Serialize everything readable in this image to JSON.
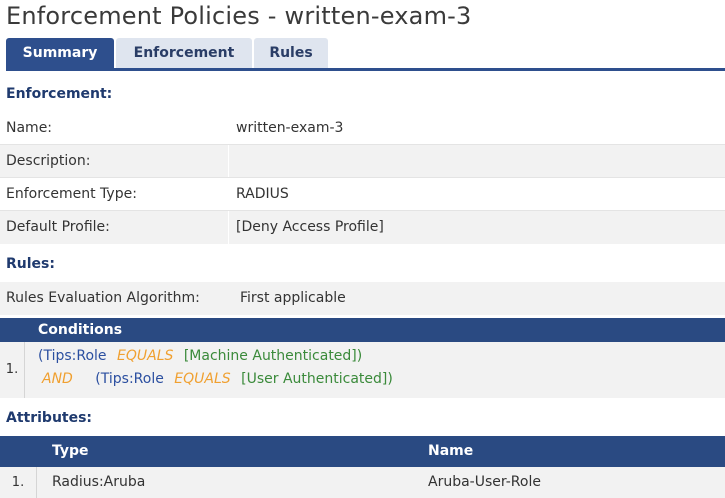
{
  "title": "Enforcement Policies - written-exam-3",
  "tabs": [
    {
      "label": "Summary",
      "active": true
    },
    {
      "label": "Enforcement",
      "active": false
    },
    {
      "label": "Rules",
      "active": false
    }
  ],
  "enforcement": {
    "heading": "Enforcement:",
    "rows": [
      {
        "label": "Name:",
        "value": "written-exam-3"
      },
      {
        "label": "Description:",
        "value": ""
      },
      {
        "label": "Enforcement Type:",
        "value": "RADIUS"
      },
      {
        "label": "Default Profile:",
        "value": "[Deny Access Profile]"
      }
    ]
  },
  "rules": {
    "heading": "Rules:",
    "algorithm_label": "Rules Evaluation Algorithm:",
    "algorithm_value": "First applicable",
    "conditions_header": "Conditions",
    "conditions": [
      {
        "index": "1.",
        "line1": {
          "open": "(Tips:Role",
          "op": "EQUALS",
          "value": "[Machine Authenticated])"
        },
        "line2": {
          "joiner": "AND",
          "open": "(Tips:Role",
          "op": "EQUALS",
          "value": "[User Authenticated])"
        }
      }
    ]
  },
  "attributes": {
    "heading": "Attributes:",
    "columns": {
      "type": "Type",
      "name": "Name"
    },
    "rows": [
      {
        "index": "1.",
        "type": "Radius:Aruba",
        "name": "Aruba-User-Role"
      }
    ]
  },
  "colors": {
    "header_blue": "#2a4a82",
    "tab_active": "#2e4f8d",
    "operator_orange": "#f0a030",
    "value_green": "#3a8a3a"
  }
}
